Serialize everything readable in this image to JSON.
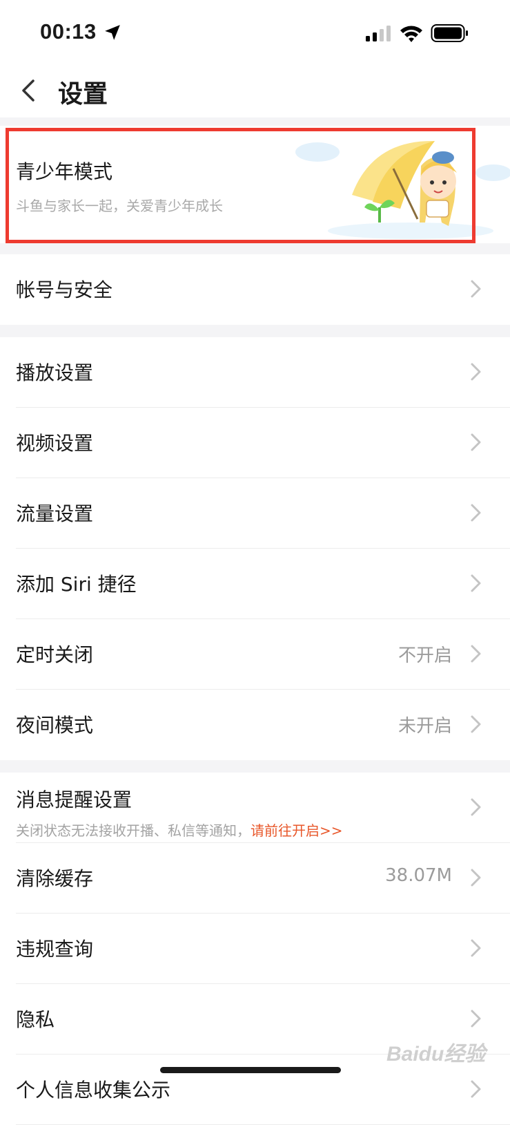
{
  "status": {
    "time": "00:13"
  },
  "nav": {
    "title": "设置"
  },
  "youth": {
    "title": "青少年模式",
    "subtitle": "斗鱼与家长一起，关爱青少年成长"
  },
  "account": {
    "label": "帐号与安全"
  },
  "settings": [
    {
      "label": "播放设置",
      "value": ""
    },
    {
      "label": "视频设置",
      "value": ""
    },
    {
      "label": "流量设置",
      "value": ""
    },
    {
      "label": "添加 Siri 捷径",
      "value": ""
    },
    {
      "label": "定时关闭",
      "value": "不开启"
    },
    {
      "label": "夜间模式",
      "value": "未开启"
    }
  ],
  "message": {
    "label": "消息提醒设置",
    "sub_text": "关闭状态无法接收开播、私信等通知，",
    "sub_link": "请前往开启>>"
  },
  "more": [
    {
      "label": "清除缓存",
      "value": "38.07M"
    },
    {
      "label": "违规查询",
      "value": ""
    },
    {
      "label": "隐私",
      "value": ""
    },
    {
      "label": "个人信息收集公示",
      "value": ""
    }
  ],
  "watermark": "Baidu经验",
  "colors": {
    "highlight": "#ee3b30",
    "link": "#e8572a",
    "background": "#f4f4f6"
  }
}
